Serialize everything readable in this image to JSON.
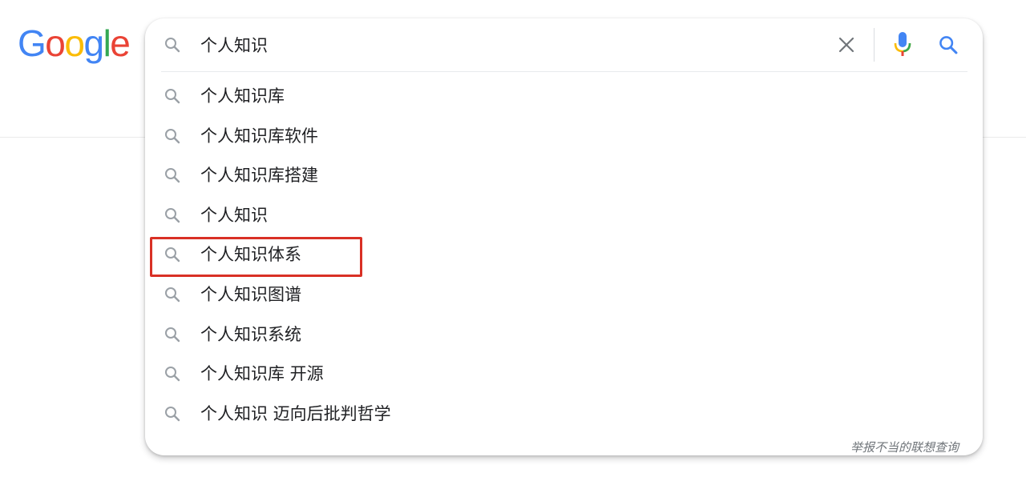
{
  "logo": {
    "letters": [
      "G",
      "o",
      "o",
      "g",
      "l",
      "e"
    ],
    "colors": [
      "#4285F4",
      "#EA4335",
      "#FBBC05",
      "#4285F4",
      "#34A853",
      "#EA4335"
    ]
  },
  "search": {
    "query": "个人知识",
    "icons": {
      "leading": "search-icon",
      "clear": "close-icon",
      "voice": "microphone-icon",
      "submit": "search-icon"
    }
  },
  "suggestions": [
    {
      "text": "个人知识库"
    },
    {
      "text": "个人知识库软件"
    },
    {
      "text": "个人知识库搭建"
    },
    {
      "text": "个人知识"
    },
    {
      "text": "个人知识体系",
      "highlighted": true
    },
    {
      "text": "个人知识图谱"
    },
    {
      "text": "个人知识系统"
    },
    {
      "text": "个人知识库 开源"
    },
    {
      "text": "个人知识 迈向后批判哲学"
    }
  ],
  "report_link": "举报不当的联想查询",
  "colors": {
    "highlight_border": "#d93025",
    "icon_gray": "#9aa0a6",
    "search_blue": "#4285F4",
    "text": "#202124"
  }
}
